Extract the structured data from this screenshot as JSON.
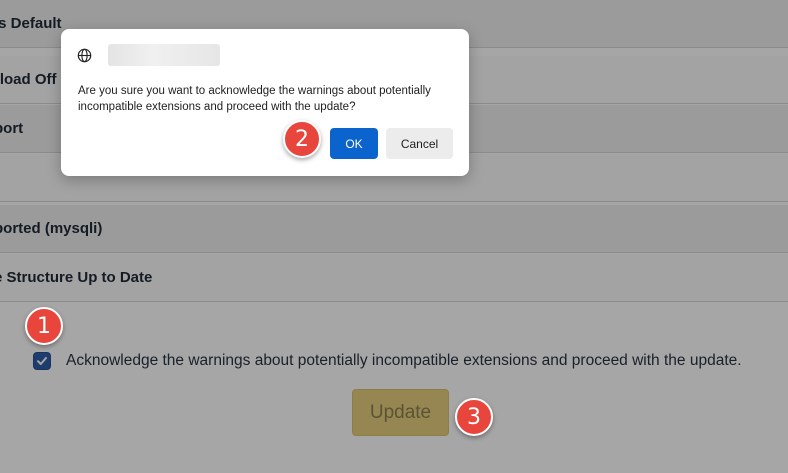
{
  "page": {
    "rows": [
      {
        "label": "is Default"
      },
      {
        "label": "rload Off"
      },
      {
        "label": "port"
      },
      {
        "label": ""
      },
      {
        "label": "ported (mysqli)"
      },
      {
        "label": "e Structure Up to Date"
      }
    ],
    "acknowledge": {
      "checked": true,
      "label": "Acknowledge the warnings about potentially incompatible extensions and proceed with the update."
    },
    "update_button": "Update"
  },
  "dialog": {
    "icon": "globe-icon",
    "message": "Are you sure you want to acknowledge the warnings about potentially incompatible extensions and proceed with the update?",
    "ok_label": "OK",
    "cancel_label": "Cancel"
  },
  "badges": {
    "step1": "1",
    "step2": "2",
    "step3": "3"
  },
  "colors": {
    "ok_button": "#0b63ce",
    "update_button": "#e6cf7f",
    "badge": "#e8453c",
    "checkbox": "#2f5fa8"
  }
}
